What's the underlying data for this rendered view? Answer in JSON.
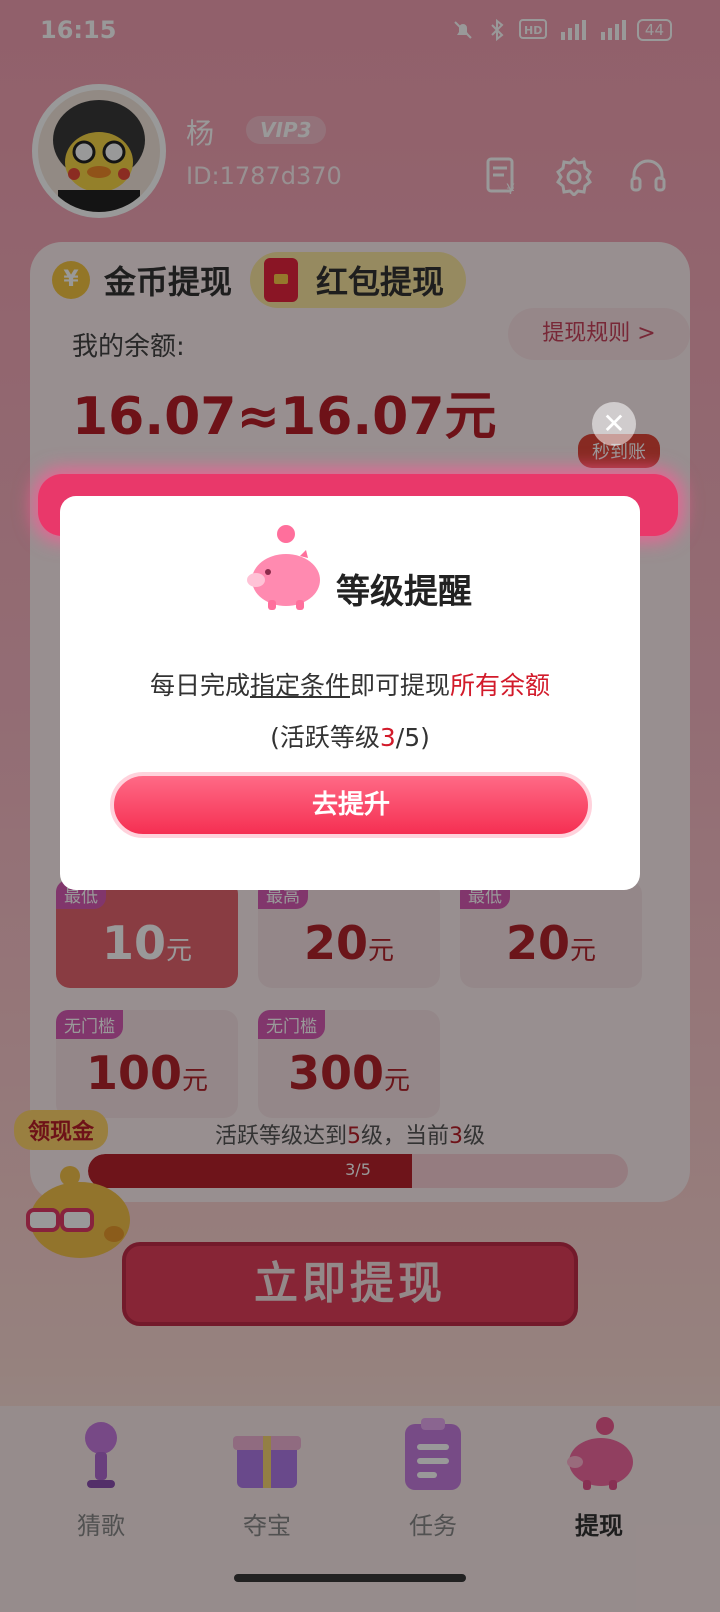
{
  "status_bar": {
    "time": "16:15",
    "battery": "44",
    "icons": [
      "mute-icon",
      "bluetooth-icon",
      "hd-icon",
      "signal-5g-icon",
      "signal-5g-icon"
    ]
  },
  "profile": {
    "name": "杨",
    "vip": "VIP3",
    "id": "ID:1787d370"
  },
  "tabs": {
    "coin": "金币提现",
    "redpack": "红包提现"
  },
  "balance": {
    "label": "我的余额:",
    "value": "16.07≈16.07元",
    "rules_button": "提现规则 >",
    "instant_badge": "秒到账"
  },
  "amounts": [
    {
      "tag": "最低",
      "value": "10",
      "unit": "元",
      "selected": true
    },
    {
      "tag": "最高",
      "value": "20",
      "unit": "元",
      "selected": false
    },
    {
      "tag": "最低",
      "value": "20",
      "unit": "元",
      "selected": false
    },
    {
      "tag": "无门槛",
      "value": "100",
      "unit": "元",
      "selected": false
    },
    {
      "tag": "无门槛",
      "value": "300",
      "unit": "元",
      "selected": false
    }
  ],
  "level_requirement": {
    "prefix": "活跃等级达到",
    "target": "5",
    "middle": "级，当前",
    "current": "3",
    "suffix": "级",
    "progress_label": "3/5",
    "progress_fraction": 0.6
  },
  "collect_badge": "领现金",
  "withdraw_button": "立即提现",
  "nav": [
    {
      "label": "猜歌",
      "icon": "microphone-icon"
    },
    {
      "label": "夺宝",
      "icon": "gift-box-icon"
    },
    {
      "label": "任务",
      "icon": "clipboard-icon"
    },
    {
      "label": "提现",
      "icon": "piggy-bank-icon",
      "active": true
    }
  ],
  "modal": {
    "title": "等级提醒",
    "msg_part1": "每日完成",
    "msg_link": "指定条件",
    "msg_part2": "即可提现",
    "msg_red": "所有余额",
    "level_prefix": "(活跃等级",
    "level_current": "3",
    "level_suffix": "/5)",
    "button": "去提升",
    "close": "✕"
  },
  "colors": {
    "accent_red": "#b81e28",
    "modal_button": "#f52f52"
  }
}
